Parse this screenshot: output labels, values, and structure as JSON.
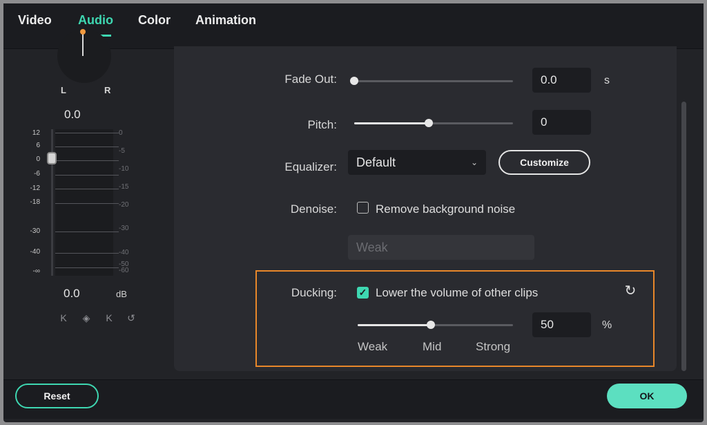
{
  "tabs": [
    {
      "label": "Video"
    },
    {
      "label": "Audio"
    },
    {
      "label": "Color"
    },
    {
      "label": "Animation"
    }
  ],
  "active_tab": "Audio",
  "accent_color": "#3ed7b1",
  "highlight_color": "#e8872a",
  "pan": {
    "left_label": "L",
    "right_label": "R",
    "value": "0.0"
  },
  "meter": {
    "left_ticks": [
      "12",
      "6",
      "0",
      "-6",
      "-12",
      "-18",
      "-30",
      "-40",
      "-∞"
    ],
    "right_ticks": [
      "0",
      "-5",
      "-10",
      "-15",
      "-20",
      "-30",
      "-40",
      "-50",
      "-60"
    ],
    "value": "0.0",
    "unit": "dB",
    "keyframe_icons": [
      "prev-keyframe-icon",
      "add-keyframe-icon",
      "next-keyframe-icon",
      "reset-icon"
    ]
  },
  "fade_out": {
    "label": "Fade Out:",
    "value": "0.0",
    "unit": "s",
    "slider_fraction": 0
  },
  "pitch": {
    "label": "Pitch:",
    "value": "0",
    "slider_fraction": 0.47
  },
  "equalizer": {
    "label": "Equalizer:",
    "selected": "Default",
    "customize_label": "Customize"
  },
  "denoise": {
    "label": "Denoise:",
    "checkbox_label": "Remove background noise",
    "checked": false,
    "level_placeholder": "Weak"
  },
  "ducking": {
    "label": "Ducking:",
    "checkbox_label": "Lower the volume of other clips",
    "checked": true,
    "value": "50",
    "unit": "%",
    "slider_fraction": 0.47,
    "scale_labels": [
      "Weak",
      "Mid",
      "Strong"
    ]
  },
  "footer": {
    "reset_label": "Reset",
    "ok_label": "OK"
  }
}
